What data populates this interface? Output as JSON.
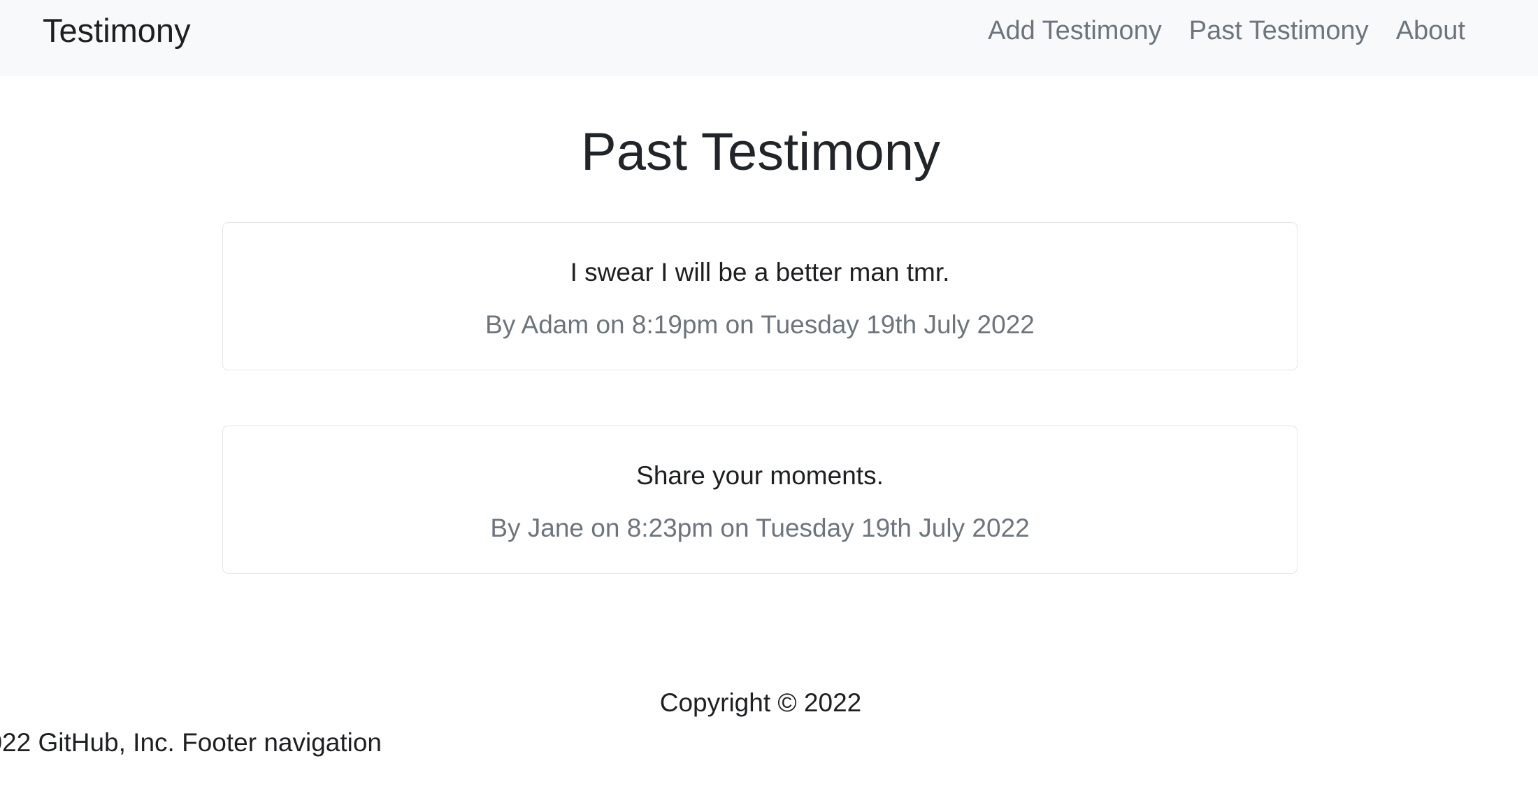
{
  "navbar": {
    "brand": "Testimony",
    "links": [
      "Add Testimony",
      "Past Testimony",
      "About"
    ]
  },
  "main": {
    "title": "Past Testimony",
    "testimonies": [
      {
        "text": "I swear I will be a better man tmr.",
        "meta": "By Adam on 8:19pm on Tuesday 19th July 2022"
      },
      {
        "text": "Share your moments.",
        "meta": "By Jane on 8:23pm on Tuesday 19th July 2022"
      }
    ]
  },
  "footer": {
    "copyright": "Copyright © 2022",
    "github": "022 GitHub, Inc. Footer navigation"
  }
}
